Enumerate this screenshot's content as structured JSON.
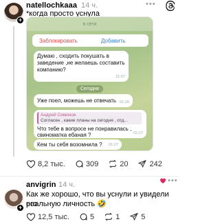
{
  "post1": {
    "username": "natellochkaaa",
    "time": "14 ч.",
    "text": "*когда просто уснула",
    "screenshot": {
      "status": "в сети",
      "block_label": "Заблокировать",
      "add_label": "Добавить",
      "msg1": "Думаю , сходить покушать в заведение ,не желаешь составить компанию?",
      "msg1_time": "21:07",
      "date_chip": "Сегодня",
      "msg2": "Уже поел, можешь не отвечать",
      "msg2_time": "01:26",
      "reply_name": "Андрей Симонов",
      "reply_text": "Согласен , какие планы на сегодня , отд...",
      "msg3": "Что тебе в вопросе не понравилась , свиноматка ебаная ?",
      "msg3_time": "01:27",
      "msg4": "Кем ты себя возомнила ?",
      "msg4_time": "01:27"
    },
    "likes": "8,2 тыс.",
    "replies": "309",
    "reposts": "20",
    "shares": "242"
  },
  "post2": {
    "username": "anvigrin",
    "time": "14 ч.",
    "text_line1": "Как же хорошо, что вы уснули и увидели его",
    "text_line2": "реальную личность 🤣",
    "likes": "12,5 тыс.",
    "replies": "5",
    "reposts": "1",
    "shares": "5"
  },
  "icons": {
    "plus": "+",
    "more": "•••"
  },
  "colors": {
    "chat_bg": "#a7c48b",
    "block_red": "#e04848",
    "add_blue": "#3a82c4",
    "reply_accent": "#c0638d"
  }
}
